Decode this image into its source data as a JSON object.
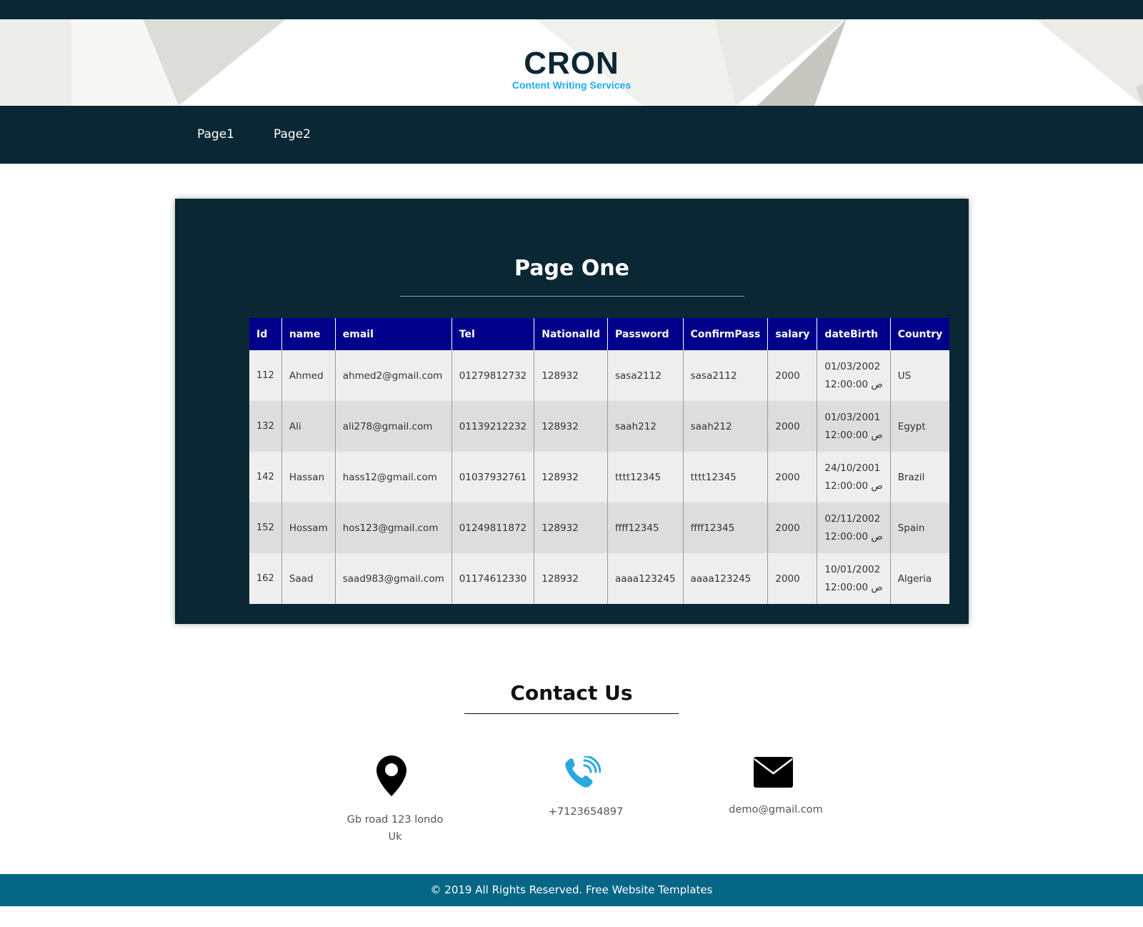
{
  "header": {
    "brand_title": "CRON",
    "brand_subtitle": "Content Writing Services"
  },
  "nav": {
    "items": [
      {
        "label": "Page1"
      },
      {
        "label": "Page2"
      }
    ]
  },
  "main": {
    "title": "Page One",
    "table": {
      "columns": [
        "Id",
        "name",
        "email",
        "Tel",
        "NationalId",
        "Password",
        "ConfirmPass",
        "salary",
        "dateBirth",
        "Country"
      ],
      "rows": [
        {
          "id": "112",
          "name": "Ahmed",
          "email": "ahmed2@gmail.com",
          "tel": "01279812732",
          "national_id": "128932",
          "password": "sasa2112",
          "confirm_pass": "sasa2112",
          "salary": "2000",
          "date": "01/03/2002",
          "time": "12:00:00 ص",
          "country": "US"
        },
        {
          "id": "132",
          "name": "Ali",
          "email": "ali278@gmail.com",
          "tel": "01139212232",
          "national_id": "128932",
          "password": "saah212",
          "confirm_pass": "saah212",
          "salary": "2000",
          "date": "01/03/2001",
          "time": "12:00:00 ص",
          "country": "Egypt"
        },
        {
          "id": "142",
          "name": "Hassan",
          "email": "hass12@gmail.com",
          "tel": "01037932761",
          "national_id": "128932",
          "password": "tttt12345",
          "confirm_pass": "tttt12345",
          "salary": "2000",
          "date": "24/10/2001",
          "time": "12:00:00 ص",
          "country": "Brazil"
        },
        {
          "id": "152",
          "name": "Hossam",
          "email": "hos123@gmail.com",
          "tel": "01249811872",
          "national_id": "128932",
          "password": "ffff12345",
          "confirm_pass": "ffff12345",
          "salary": "2000",
          "date": "02/11/2002",
          "time": "12:00:00 ص",
          "country": "Spain"
        },
        {
          "id": "162",
          "name": "Saad",
          "email": "saad983@gmail.com",
          "tel": "01174612330",
          "national_id": "128932",
          "password": "aaaa123245",
          "confirm_pass": "aaaa123245",
          "salary": "2000",
          "date": "10/01/2002",
          "time": "12:00:00 ص",
          "country": "Algeria"
        }
      ]
    }
  },
  "contact": {
    "title": "Contact Us",
    "address_line1": "Gb road 123 londo",
    "address_line2": "Uk",
    "phone": "+7123654897",
    "email": "demo@gmail.com",
    "icons": {
      "address": "map-pin-icon",
      "phone": "phone-icon",
      "email": "envelope-icon"
    },
    "phone_icon_color": "#29a8e0"
  },
  "footer": {
    "text": "© 2019 All Rights Reserved. Free Website Templates"
  },
  "colors": {
    "dark": "#0a2733",
    "table_header": "#00008b",
    "accent": "#1eaaf1",
    "footer": "#066686"
  }
}
